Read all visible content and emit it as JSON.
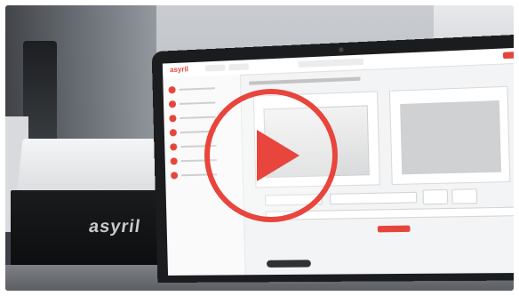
{
  "background": {
    "box_logo": "asyril",
    "laptop_brand": "asyril"
  },
  "play_button": {
    "icon": "play-icon",
    "color": "#e8453c"
  },
  "colors": {
    "accent": "#e4463b"
  }
}
